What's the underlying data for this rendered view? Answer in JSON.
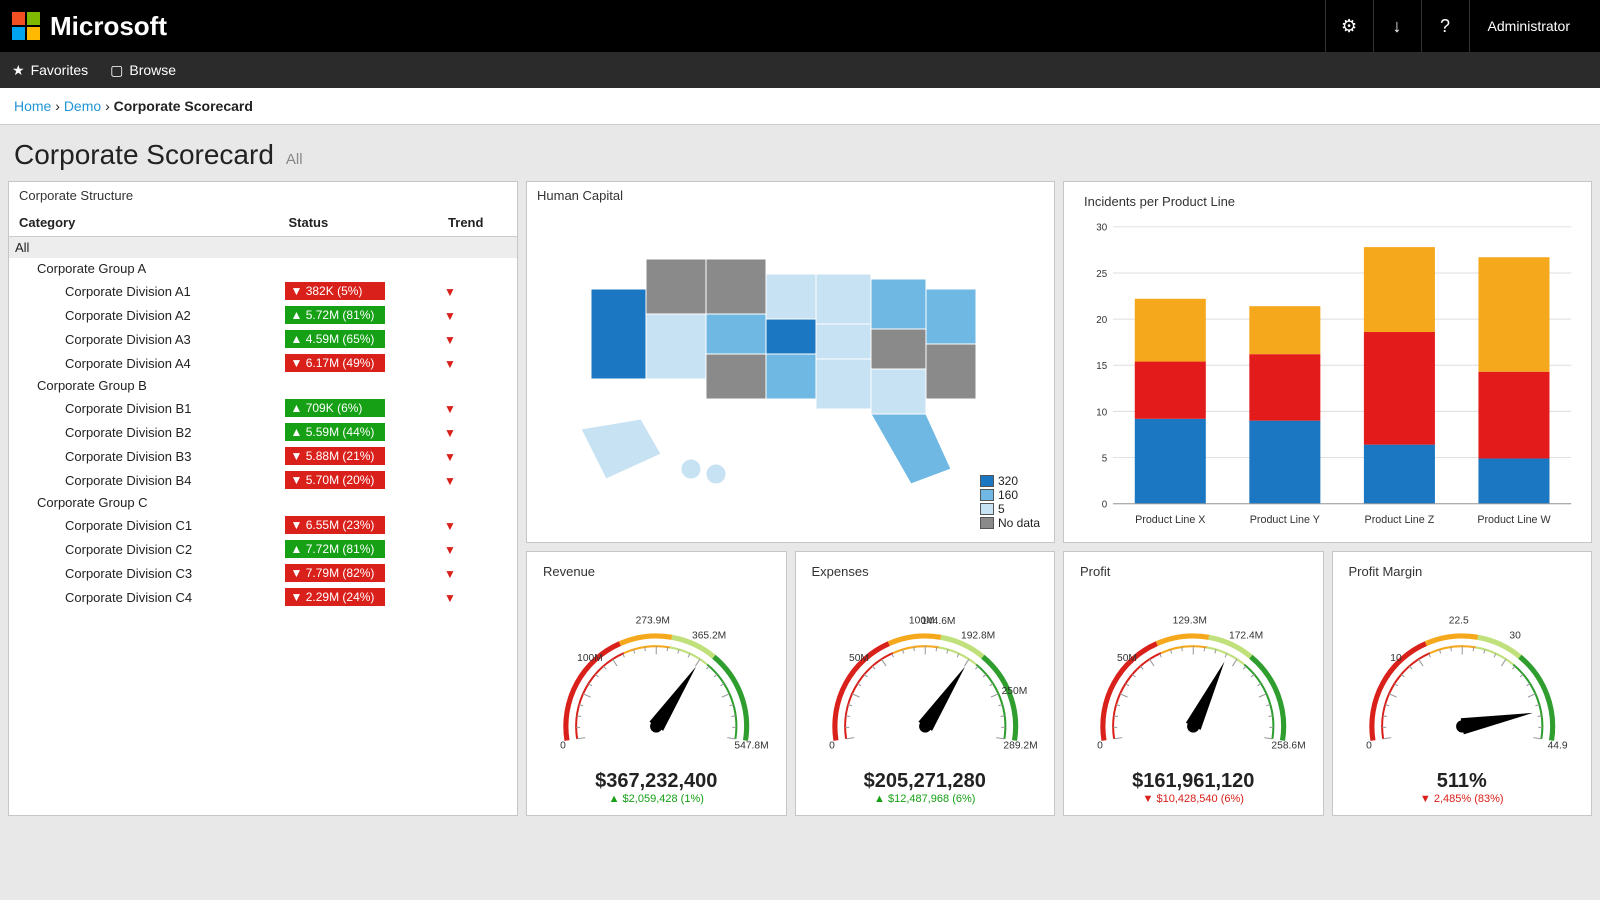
{
  "brand": "Microsoft",
  "user": "Administrator",
  "nav": {
    "favorites": "Favorites",
    "browse": "Browse"
  },
  "breadcrumb": {
    "home": "Home",
    "demo": "Demo",
    "current": "Corporate Scorecard",
    "sep": "›"
  },
  "page_title": "Corporate Scorecard",
  "page_subtitle": "All",
  "icons": {
    "settings": "gear",
    "download": "download",
    "help": "?",
    "star": "star",
    "browse": "square"
  },
  "structure": {
    "title": "Corporate Structure",
    "cols": {
      "category": "Category",
      "status": "Status",
      "trend": "Trend"
    },
    "all_label": "All",
    "groups": [
      {
        "name": "Corporate Group A",
        "rows": [
          {
            "name": "Corporate Division A1",
            "color": "red",
            "dir": "down",
            "text": "382K (5%)",
            "trend": "down"
          },
          {
            "name": "Corporate Division A2",
            "color": "green",
            "dir": "up",
            "text": "5.72M (81%)",
            "trend": "down"
          },
          {
            "name": "Corporate Division A3",
            "color": "green",
            "dir": "up",
            "text": "4.59M (65%)",
            "trend": "down"
          },
          {
            "name": "Corporate Division A4",
            "color": "red",
            "dir": "down",
            "text": "6.17M (49%)",
            "trend": "down"
          }
        ]
      },
      {
        "name": "Corporate Group B",
        "rows": [
          {
            "name": "Corporate Division B1",
            "color": "green",
            "dir": "up",
            "text": "709K (6%)",
            "trend": "down"
          },
          {
            "name": "Corporate Division B2",
            "color": "green",
            "dir": "up",
            "text": "5.59M (44%)",
            "trend": "down"
          },
          {
            "name": "Corporate Division B3",
            "color": "red",
            "dir": "down",
            "text": "5.88M (21%)",
            "trend": "down"
          },
          {
            "name": "Corporate Division B4",
            "color": "red",
            "dir": "down",
            "text": "5.70M (20%)",
            "trend": "down"
          }
        ]
      },
      {
        "name": "Corporate Group C",
        "rows": [
          {
            "name": "Corporate Division C1",
            "color": "red",
            "dir": "down",
            "text": "6.55M (23%)",
            "trend": "down"
          },
          {
            "name": "Corporate Division C2",
            "color": "green",
            "dir": "up",
            "text": "7.72M (81%)",
            "trend": "down"
          },
          {
            "name": "Corporate Division C3",
            "color": "red",
            "dir": "down",
            "text": "7.79M (82%)",
            "trend": "down"
          },
          {
            "name": "Corporate Division C4",
            "color": "red",
            "dir": "down",
            "text": "2.29M (24%)",
            "trend": "down"
          }
        ]
      }
    ]
  },
  "map": {
    "title": "Human Capital",
    "legend": [
      {
        "label": "320",
        "color": "#1b77c1"
      },
      {
        "label": "160",
        "color": "#6fb8e4"
      },
      {
        "label": "5",
        "color": "#c7e2f3"
      },
      {
        "label": "No data",
        "color": "#8a8a8a"
      }
    ]
  },
  "chart_data": {
    "type": "bar",
    "title": "Incidents per Product Line",
    "ylim": [
      0,
      30
    ],
    "yticks": [
      0,
      5,
      10,
      15,
      20,
      25,
      30
    ],
    "categories": [
      "Product Line X",
      "Product Line Y",
      "Product Line Z",
      "Product Line W"
    ],
    "series": [
      {
        "name": "blue",
        "color": "#1b77c1",
        "values": [
          9.2,
          9.0,
          6.4,
          4.9
        ]
      },
      {
        "name": "red",
        "color": "#e31b1b",
        "values": [
          6.2,
          7.2,
          12.2,
          9.4
        ]
      },
      {
        "name": "yellow",
        "color": "#f6a81c",
        "values": [
          6.8,
          5.2,
          9.2,
          12.4
        ]
      }
    ]
  },
  "gauges": [
    {
      "title": "Revenue",
      "value": "$367,232,400",
      "delta": "$2,059,428 (1%)",
      "dir": "up",
      "ticks": {
        "min": "0",
        "t1": "100M",
        "t2": "273.9M",
        "peak": "365.2M",
        "max": "547.8M"
      },
      "needle": 0.67
    },
    {
      "title": "Expenses",
      "value": "$205,271,280",
      "delta": "$12,487,968 (6%)",
      "dir": "up",
      "ticks": {
        "min": "0",
        "t1": "50M",
        "t2": "100M",
        "t22": "144.6M",
        "peak": "192.8M",
        "t3": "250M",
        "max": "289.2M"
      },
      "needle": 0.67
    },
    {
      "title": "Profit",
      "value": "$161,961,120",
      "delta": "$10,428,540 (6%)",
      "dir": "down",
      "ticks": {
        "min": "0",
        "t1": "50M",
        "t2": "129.3M",
        "peak": "172.4M",
        "max": "258.6M"
      },
      "needle": 0.63
    },
    {
      "title": "Profit Margin",
      "value": "511%",
      "delta": "2,485% (83%)",
      "dir": "down",
      "ticks": {
        "min": "0",
        "t1": "10",
        "t2": "22.5",
        "peak": "30",
        "max": "44.9"
      },
      "needle": 0.9
    }
  ]
}
